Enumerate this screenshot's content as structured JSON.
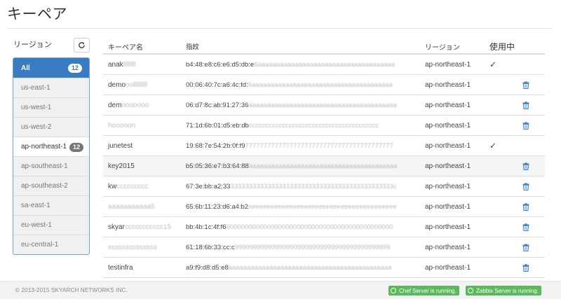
{
  "page": {
    "title": "キーペア"
  },
  "sidebar": {
    "label": "リージョン",
    "items": [
      {
        "label": "All",
        "badge": "12"
      },
      {
        "label": "us-east-1"
      },
      {
        "label": "us-west-1"
      },
      {
        "label": "us-west-2"
      },
      {
        "label": "ap-northeast-1",
        "badge": "12"
      },
      {
        "label": "ap-southeast-1"
      },
      {
        "label": "ap-southeast-2"
      },
      {
        "label": "sa-east-1"
      },
      {
        "label": "eu-west-1"
      },
      {
        "label": "eu-central-1"
      }
    ]
  },
  "table": {
    "headers": {
      "name": "キーペア名",
      "fingerprint": "指紋",
      "region": "リージョン",
      "in_use": "使用中"
    },
    "rows": [
      {
        "name": "anak",
        "name_blur": "llllllll",
        "fp": "b4:48:e8:c6:e6:d5:db:e",
        "fp_blur": "5aaaaaaaaaaaaaaaaaaaaaaaaaaaaaaaaaaaaa",
        "region": "ap-northeast-1",
        "in_use": "✓",
        "delete": false
      },
      {
        "name": "demo",
        "name_blur": "oolllllllll",
        "fp": "00:06:40:7c:a6:4c:fd:",
        "fp_blur": "6aaaaaaaaaaaaaaaaaaaaaaaaaaaaaaaaaaaaaa",
        "region": "ap-northeast-1",
        "in_use": "",
        "delete": true
      },
      {
        "name": "dem",
        "name_blur": "ooooooo",
        "fp": "06:d7:8c:ab:91:27:36",
        "fp_blur": "aaaaaaaaaaaaaaaaaaaaaaaaaaaaaaaaaaaaaaaa",
        "region": "ap-northeast-1",
        "in_use": "",
        "delete": true
      },
      {
        "name": "",
        "name_blur": "hooooon",
        "fp": "71:1d:6b:01:d5:eb:db",
        "fp_blur": "ccccccccccccccccccccccccccccccccccccccc",
        "region": "ap-northeast-1",
        "in_use": "",
        "delete": true
      },
      {
        "name": "junetest",
        "name_blur": "",
        "fp": "19:68:7e:54:2b:0f:f9",
        "fp_blur": "7777777777777777777777777777777777777777",
        "region": "ap-northeast-1",
        "in_use": "✓",
        "delete": false
      },
      {
        "name": "key2015",
        "name_blur": "",
        "fp": "b5:05:36:e7:b3:64:88",
        "fp_blur": "aaaaaaaaaaaaaaaaaaaaaaaaaaaaaaaaaaaaaaaa",
        "region": "ap-northeast-1",
        "in_use": "",
        "delete": true
      },
      {
        "name": "kw",
        "name_blur": "ccccccccc",
        "fp": "67:3e:bb:a2:33",
        "fp_blur": "33333333333333333333333333333333333333333333c",
        "region": "ap-northeast-1",
        "in_use": "",
        "delete": true
      },
      {
        "name": "",
        "name_blur": "aaaaaaaaaaa5",
        "fp": "65:6b:11:23:d6:a4:b2",
        "fp_blur": "eeeeeeeeeeeeeeeeeeeeeeeeeeeeeeeeeeeeeeee",
        "region": "ap-northeast-1",
        "in_use": "",
        "delete": true
      },
      {
        "name": "skyar",
        "name_blur": "ccccccccccc15",
        "fp": "bb:4b:1c:4f:f6",
        "fp_blur": "000000000000000000000000000000000000000000000",
        "region": "ap-northeast-1",
        "in_use": "",
        "delete": true
      },
      {
        "name": "",
        "name_blur": "ssssssssssssss",
        "fp": "61:18:6b:33:cc:c",
        "fp_blur": "999999999999999999999999999999999999999999",
        "region": "ap-northeast-1",
        "in_use": "",
        "delete": true
      },
      {
        "name": "testinfra",
        "name_blur": "",
        "fp": "a9:f9:d8:d5:e8",
        "fp_blur": "aaaaaaaaaaaaaaaaaaaaaaaaaaaaaaaaaaaaaaaaaaaa",
        "region": "ap-northeast-1",
        "in_use": "",
        "delete": true
      }
    ]
  },
  "footer": {
    "copyright": "© 2013-2015 SKYARCH NETWORKS INC.",
    "status_chef": "Chef Server is running.",
    "status_zabbix": "Zabbix Server is running."
  },
  "colors": {
    "accent": "#3a7cc1",
    "success": "#5cb85c",
    "trash_icon": "#3a7cc1"
  }
}
